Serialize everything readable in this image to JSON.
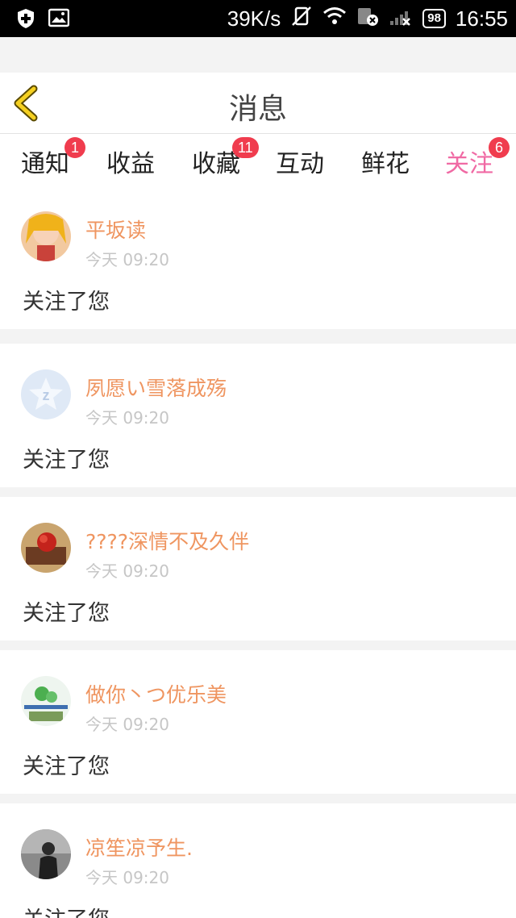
{
  "status_bar": {
    "speed": "39K/s",
    "battery": "98",
    "time": "16:55"
  },
  "header": {
    "title": "消息"
  },
  "tabs": [
    {
      "label": "通知",
      "badge": "1",
      "active": false
    },
    {
      "label": "收益",
      "badge": "",
      "active": false
    },
    {
      "label": "收藏",
      "badge": "11",
      "active": false
    },
    {
      "label": "互动",
      "badge": "",
      "active": false
    },
    {
      "label": "鲜花",
      "badge": "",
      "active": false
    },
    {
      "label": "关注",
      "badge": "6",
      "active": true
    }
  ],
  "feed": [
    {
      "name": "平坂读",
      "time": "今天 09:20",
      "message": "关注了您"
    },
    {
      "name": "夙愿い雪落成殇",
      "time": "今天 09:20",
      "message": "关注了您"
    },
    {
      "name": "????深情不及久伴",
      "time": "今天 09:20",
      "message": "关注了您"
    },
    {
      "name": "做你丶つ优乐美",
      "time": "今天 09:20",
      "message": "关注了您"
    },
    {
      "name": "凉笙凉予生.",
      "time": "今天 09:20",
      "message": "关注了您"
    }
  ],
  "colors": {
    "accent": "#f06aa4",
    "name_color": "#ef9560",
    "badge": "#f03c4e",
    "back_arrow": "#f5d020"
  }
}
